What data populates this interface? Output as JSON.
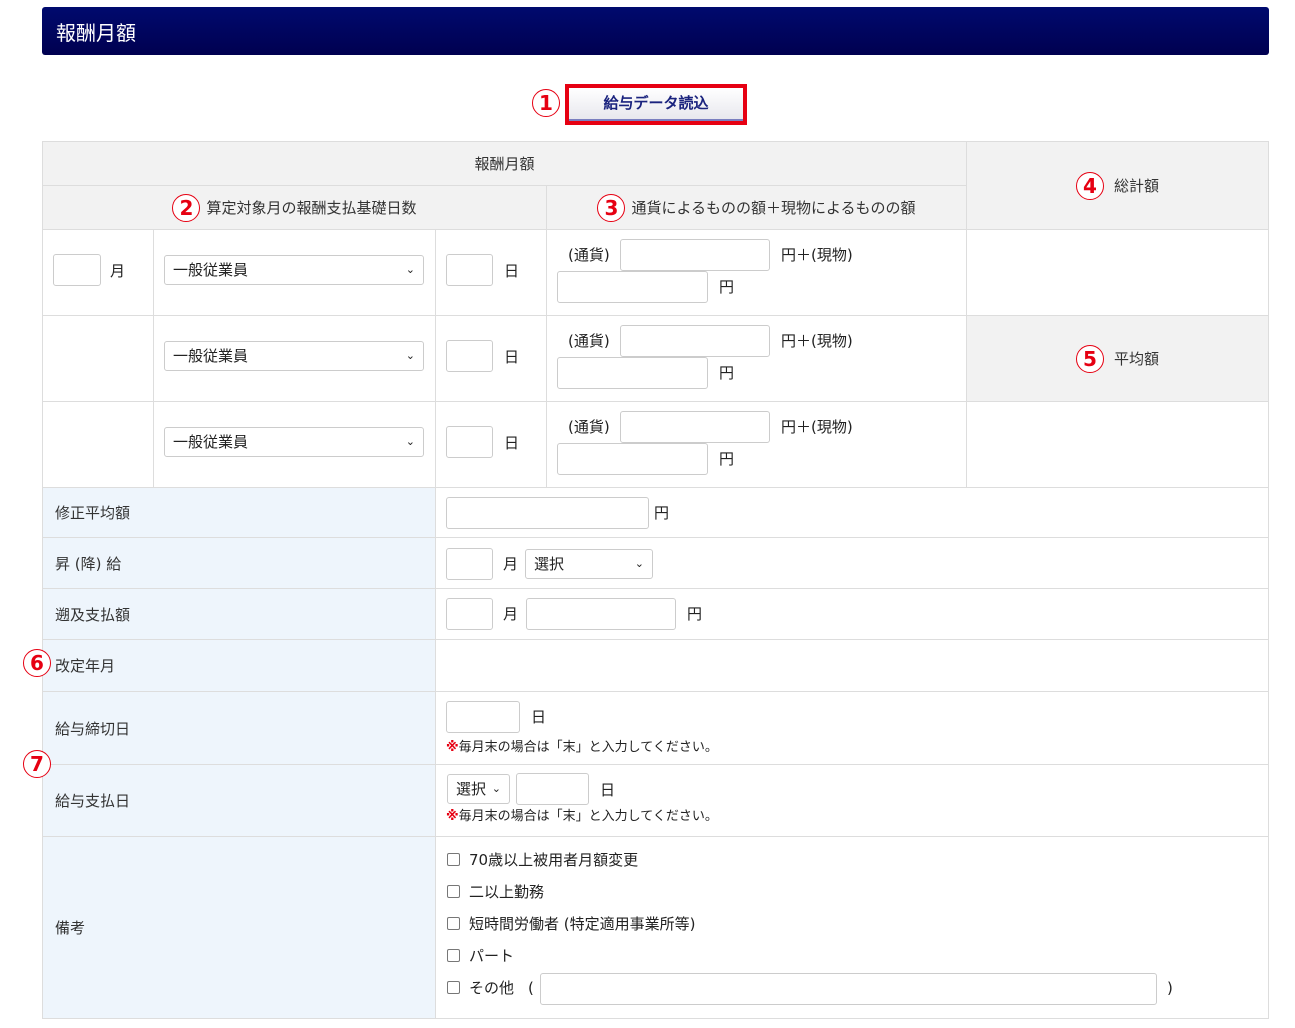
{
  "title": "報酬月額",
  "load_button": "給与データ読込",
  "annotations": [
    "1",
    "2",
    "3",
    "4",
    "5",
    "6",
    "7"
  ],
  "header": {
    "main": "報酬月額",
    "days": "算定対象月の報酬支払基礎日数",
    "amount": "通貨によるものの額＋現物によるものの額",
    "total": "総計額",
    "average": "平均額"
  },
  "rows": [
    {
      "month_unit": "月",
      "employee_type": "一般従業員",
      "day_unit": "日",
      "currency_label": "(通貨)",
      "plus_goods": "円＋(現物)",
      "yen": "円"
    },
    {
      "employee_type": "一般従業員",
      "day_unit": "日",
      "currency_label": "(通貨)",
      "plus_goods": "円＋(現物)",
      "yen": "円"
    },
    {
      "employee_type": "一般従業員",
      "day_unit": "日",
      "currency_label": "(通貨)",
      "plus_goods": "円＋(現物)",
      "yen": "円"
    }
  ],
  "fields": {
    "corrected_avg": {
      "label": "修正平均額",
      "unit": "円"
    },
    "raise": {
      "label": "昇 (降) 給",
      "month": "月",
      "select": "選択"
    },
    "retro": {
      "label": "遡及支払額",
      "month": "月",
      "unit": "円"
    },
    "revision": {
      "label": "改定年月"
    },
    "closing": {
      "label": "給与締切日",
      "unit": "日",
      "note_mark": "※",
      "note": "毎月末の場合は「末」と入力してください。"
    },
    "payday": {
      "label": "給与支払日",
      "select": "選択",
      "unit": "日",
      "note_mark": "※",
      "note": "毎月末の場合は「末」と入力してください。"
    },
    "remarks": {
      "label": "備考",
      "options": [
        "70歳以上被用者月額変更",
        "二以上勤務",
        "短時間労働者 (特定適用事業所等)",
        "パート",
        "その他"
      ],
      "open_paren": "(",
      "close_paren": ")"
    }
  }
}
